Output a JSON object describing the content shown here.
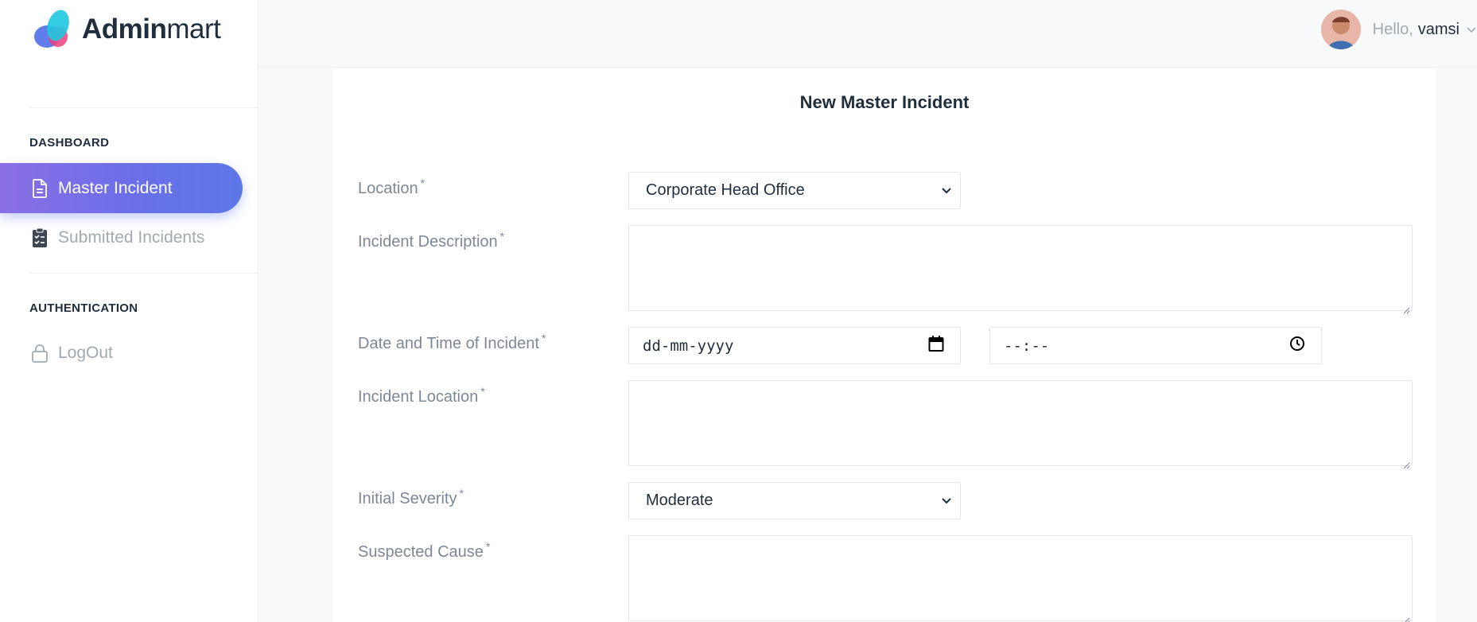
{
  "brand": {
    "name_bold": "Admin",
    "name_light": "mart"
  },
  "sidebar": {
    "sections": [
      {
        "title": "DASHBOARD"
      },
      {
        "title": "AUTHENTICATION"
      }
    ],
    "items": [
      {
        "label": "Master Incident",
        "icon": "file-text-icon",
        "active": true
      },
      {
        "label": "Submitted Incidents",
        "icon": "clipboard-check-icon",
        "active": false
      },
      {
        "label": "LogOut",
        "icon": "lock-icon",
        "active": false
      }
    ]
  },
  "header": {
    "greeting": "Hello,",
    "username": "vamsi"
  },
  "form": {
    "title": "New Master Incident",
    "required_mark": "*",
    "location": {
      "label": "Location",
      "value": "Corporate Head Office"
    },
    "description": {
      "label": "Incident Description",
      "value": ""
    },
    "datetime": {
      "label": "Date and Time of Incident",
      "date_placeholder": "dd-mm-yyyy",
      "time_placeholder": "--:--"
    },
    "incident_location": {
      "label": "Incident Location",
      "value": ""
    },
    "severity": {
      "label": "Initial Severity",
      "value": "Moderate"
    },
    "cause": {
      "label": "Suspected Cause",
      "value": ""
    }
  },
  "colors": {
    "accent_start": "#8b6fe6",
    "accent_end": "#5c77e6",
    "text_dark": "#1f2d3d",
    "text_muted": "#7c8798"
  }
}
